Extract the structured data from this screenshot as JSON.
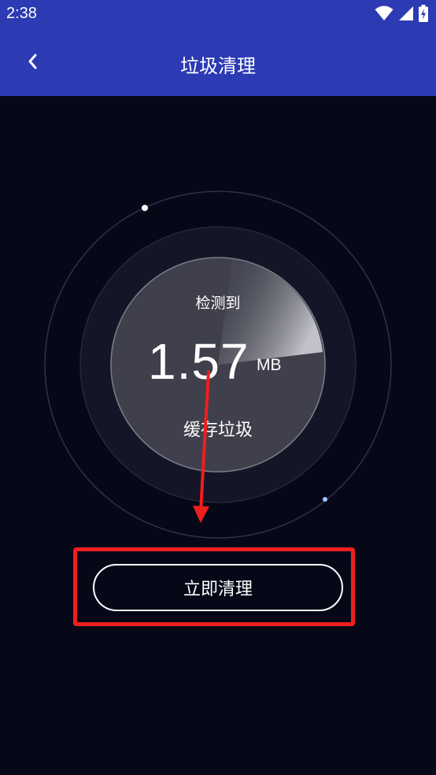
{
  "status_bar": {
    "time": "2:38",
    "icons": [
      "wifi-icon",
      "signal-icon",
      "battery-icon"
    ]
  },
  "app_bar": {
    "title": "垃圾清理",
    "back_icon": "chevron-left-icon"
  },
  "gauge": {
    "detect_label": "检测到",
    "size_value": "1.57",
    "size_unit": "MB",
    "cache_label": "缓存垃圾"
  },
  "actions": {
    "clean_now_label": "立即清理"
  },
  "colors": {
    "header": "#2c3ab3",
    "background": "#060818",
    "highlight": "#f01e1e"
  }
}
